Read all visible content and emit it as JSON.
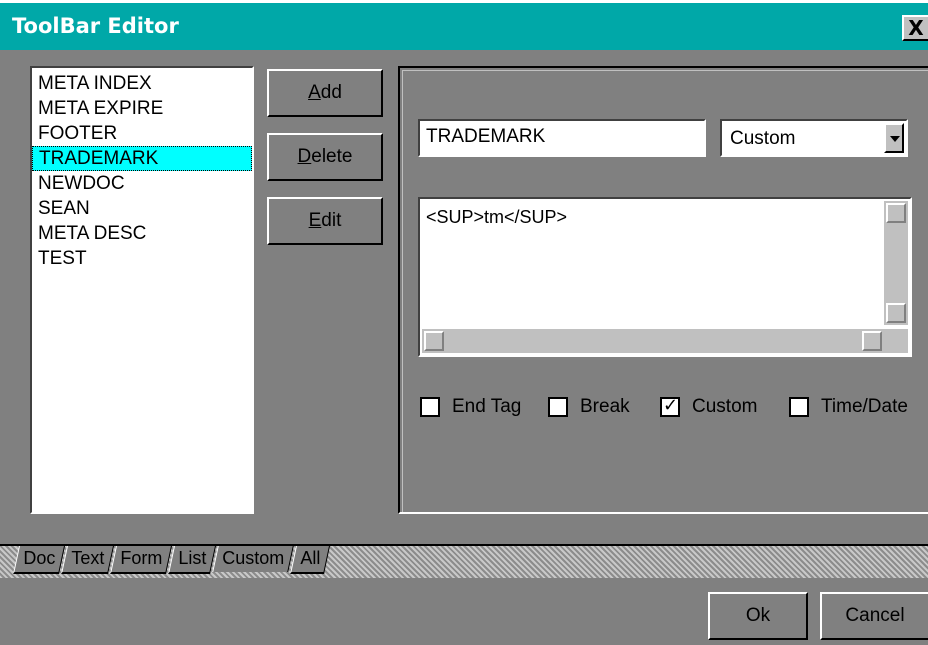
{
  "window": {
    "title": "ToolBar Editor",
    "close_label": "X"
  },
  "list": {
    "items": [
      "META INDEX",
      "META EXPIRE",
      "FOOTER",
      "TRADEMARK",
      "NEWDOC",
      "SEAN",
      "META DESC",
      "TEST"
    ],
    "selected_index": 3
  },
  "buttons": {
    "add": "Add",
    "delete": "Delete",
    "edit": "Edit",
    "ok": "Ok",
    "cancel": "Cancel"
  },
  "editor": {
    "name_value": "TRADEMARK",
    "type_value": "Custom",
    "code_value": "<SUP>tm</SUP>"
  },
  "options": [
    {
      "label": "End Tag",
      "checked": false
    },
    {
      "label": "Break",
      "checked": false
    },
    {
      "label": "Custom",
      "checked": true
    },
    {
      "label": "Time/Date",
      "checked": false
    }
  ],
  "tabs": [
    "Doc",
    "Text",
    "Form",
    "List",
    "Custom",
    "All"
  ],
  "active_tab": "Custom"
}
